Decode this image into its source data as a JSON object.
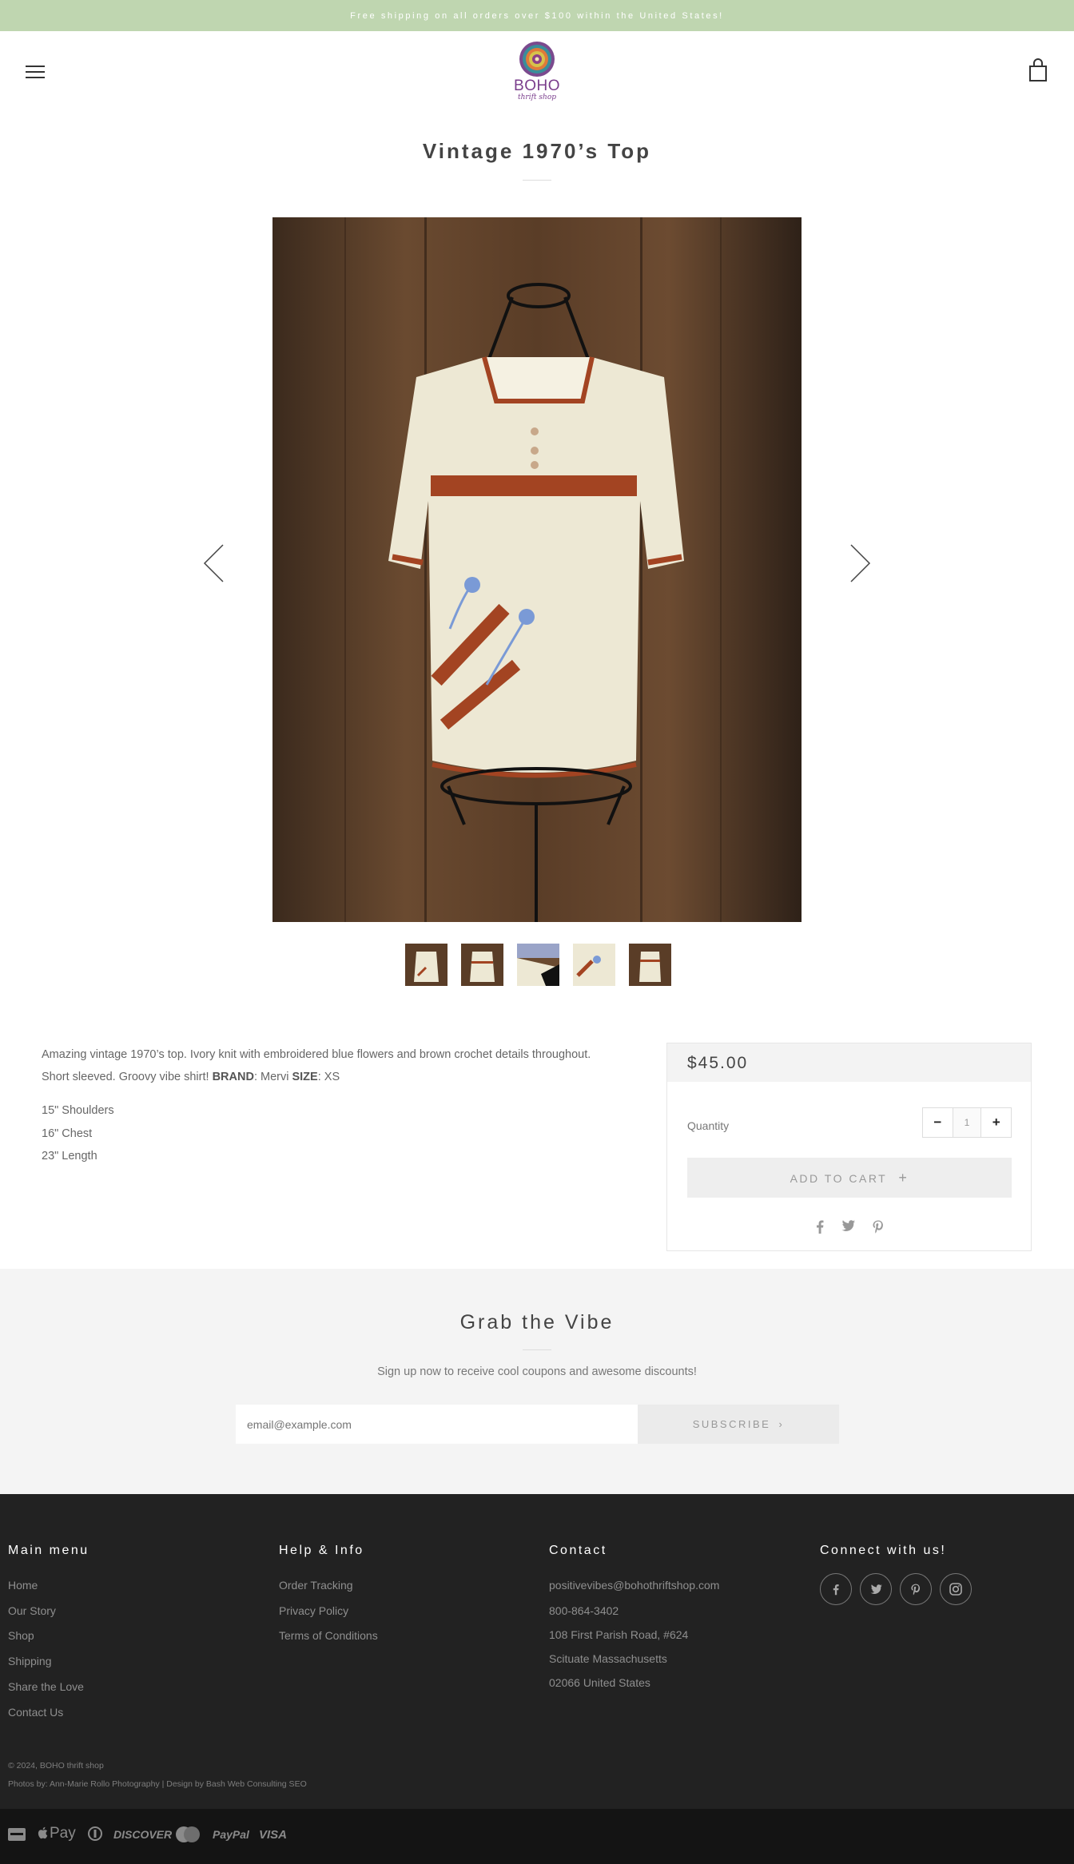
{
  "announcement": "Free shipping on all orders over $100 within the United States!",
  "logo": {
    "name": "BOHO",
    "tagline": "thrift shop"
  },
  "product": {
    "title": "Vintage 1970’s Top",
    "description": "Amazing vintage 1970’s top. Ivory knit with embroidered blue flowers and brown crochet details throughout. Short sleeved. Groovy vibe shirt!",
    "brand_label": "BRAND",
    "brand_value": "Mervi",
    "size_label": "SIZE",
    "size_value": "XS",
    "measurements": [
      "15\" Shoulders",
      "16\" Chest",
      "23\" Length"
    ],
    "price": "$45.00",
    "quantity_label": "Quantity",
    "quantity": "1",
    "qty_minus": "−",
    "qty_plus": "+",
    "add_to_cart": "ADD TO CART",
    "thumbnail_count": 5
  },
  "newsletter": {
    "title": "Grab the Vibe",
    "subtitle": "Sign up now to receive cool coupons and awesome discounts!",
    "placeholder": "email@example.com",
    "button": "SUBSCRIBE"
  },
  "footer": {
    "main_menu": {
      "title": "Main menu",
      "items": [
        "Home",
        "Our Story",
        "Shop",
        "Shipping",
        "Share the Love",
        "Contact Us"
      ]
    },
    "help": {
      "title": "Help & Info",
      "items": [
        "Order Tracking",
        "Privacy Policy",
        "Terms of Conditions"
      ]
    },
    "contact": {
      "title": "Contact",
      "email": "positivevibes@bohothriftshop.com",
      "phone": "800-864-3402",
      "address1": "108 First Parish Road, #624",
      "address2": "Scituate Massachusetts",
      "address3": "02066 United States"
    },
    "connect": {
      "title": "Connect with us!",
      "icons": [
        "facebook-icon",
        "twitter-icon",
        "pinterest-icon",
        "instagram-icon"
      ]
    },
    "copyright": "© 2024, BOHO thrift shop",
    "credits": "Photos by: Ann-Marie Rollo Photography | Design by Bash Web Consulting SEO"
  },
  "payments": {
    "apple_pay": "Pay",
    "discover": "DISCOVER",
    "paypal": "PayPal",
    "visa": "VISA"
  },
  "colors": {
    "announcement_bg": "#bfd6b0",
    "brand_purple": "#7a3d8c",
    "footer_bg": "#222222",
    "paybar_bg": "#141414"
  }
}
